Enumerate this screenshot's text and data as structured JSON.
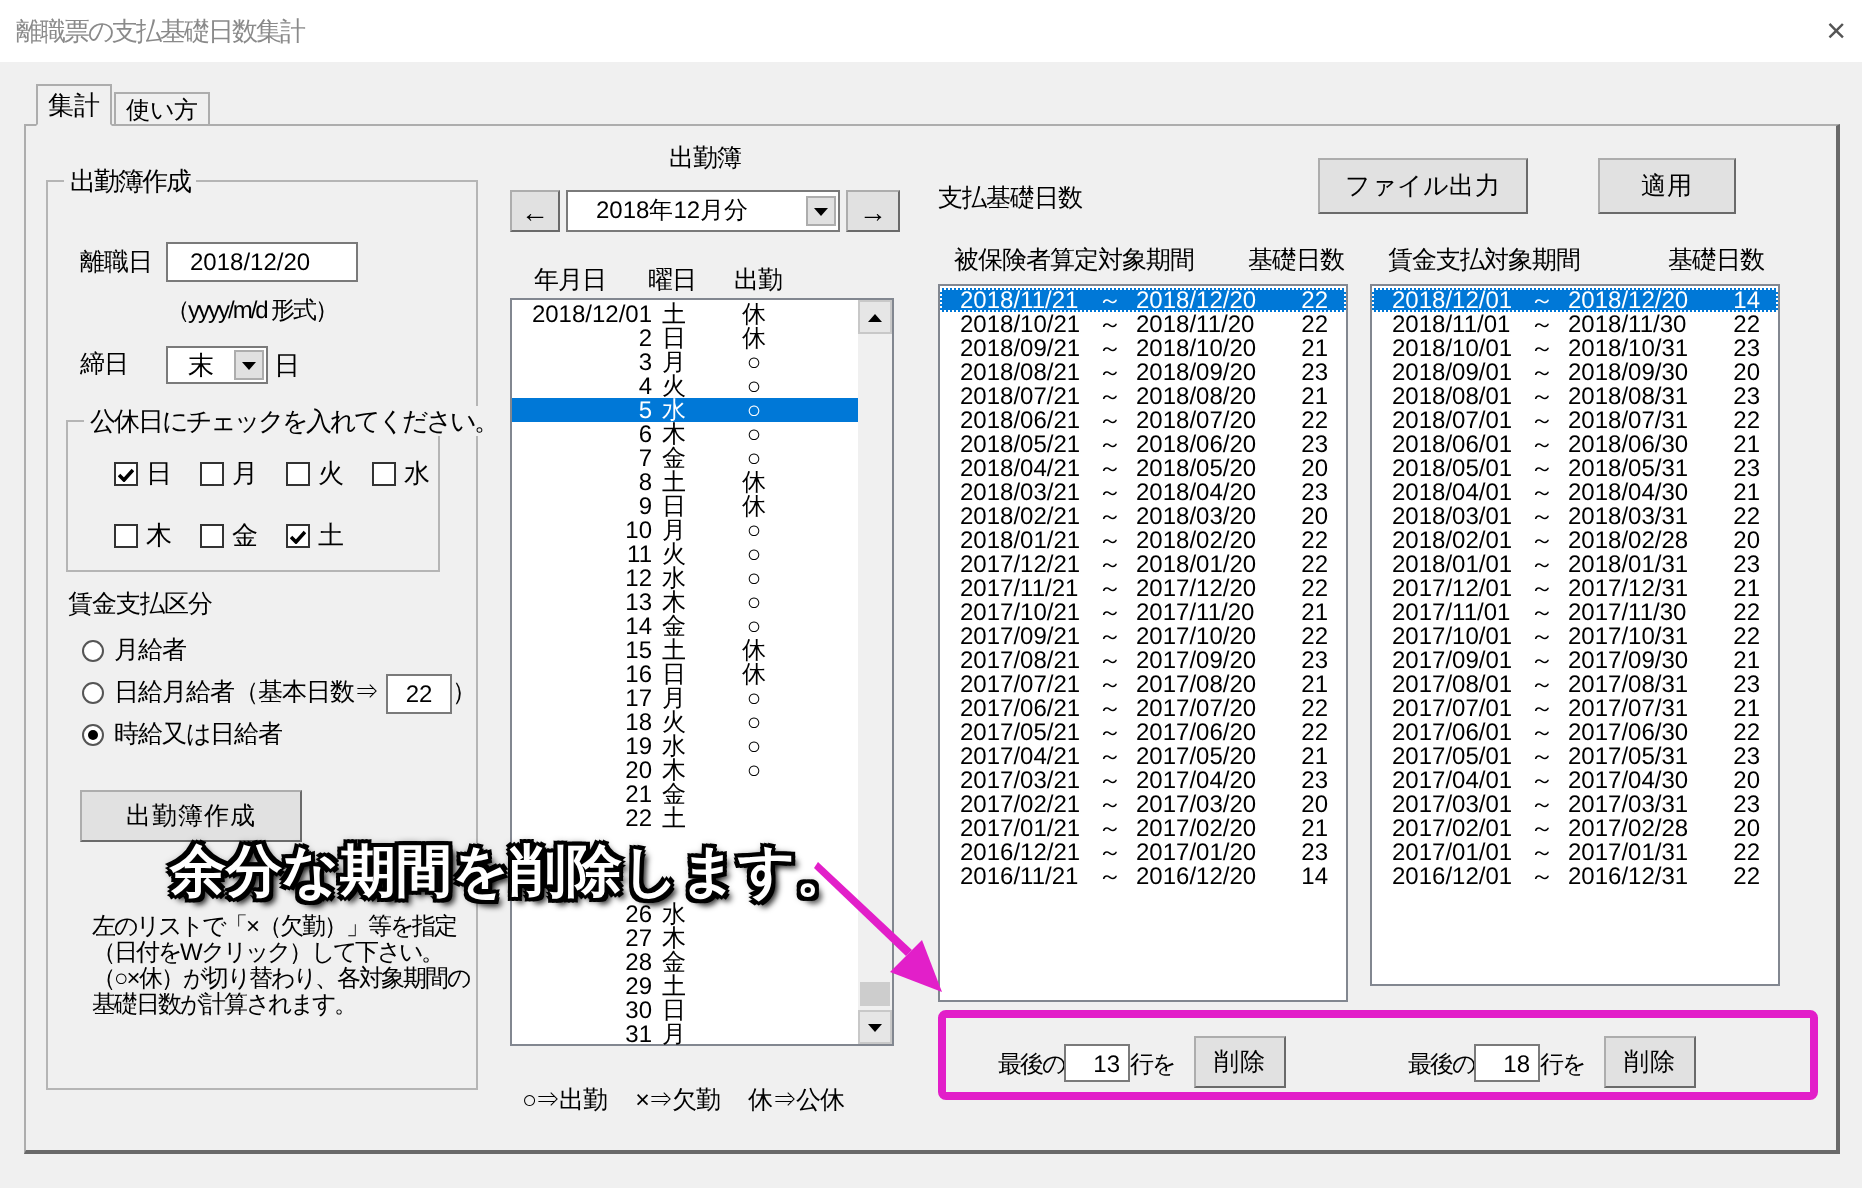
{
  "window": {
    "title": "離職票の支払基礎日数集計",
    "close": "×"
  },
  "tabs": [
    {
      "label": "集計",
      "selected": true
    },
    {
      "label": "使い方",
      "selected": false
    }
  ],
  "attendance_setup": {
    "title": "出勤簿作成",
    "leave_date_label": "離職日",
    "leave_date": "2018/12/20",
    "format_hint": "（yyyy/m/d 形式）",
    "closing_label": "締日",
    "closing_value": "末",
    "closing_suffix": "日",
    "holidays": {
      "title": "公休日にチェックを入れてください。",
      "days": [
        {
          "label": "日",
          "checked": true
        },
        {
          "label": "月",
          "checked": false
        },
        {
          "label": "火",
          "checked": false
        },
        {
          "label": "水",
          "checked": false
        },
        {
          "label": "木",
          "checked": false
        },
        {
          "label": "金",
          "checked": false
        },
        {
          "label": "土",
          "checked": true
        }
      ]
    },
    "wage_title": "賃金支払区分",
    "wage_options": [
      {
        "kind": "plain",
        "label": "月給者",
        "selected": false
      },
      {
        "kind": "with_days",
        "label": "日給月給者（基本日数⇒",
        "days": "22",
        "suffix": "）",
        "selected": false
      },
      {
        "kind": "plain",
        "label": "時給又は日給者",
        "selected": true
      }
    ],
    "create_button": "出勤簿作成",
    "note": "左のリストで「×（欠勤）」等を指定（日付をWクリック）して下さい。（○×休）が切り替わり、各対象期間の基礎日数が計算されます。"
  },
  "attendance_book": {
    "title": "出勤簿",
    "prev": "←",
    "month": "2018年12月分",
    "next": "→",
    "columns": [
      "年月日",
      "曜日",
      "出勤"
    ],
    "rows": [
      {
        "kind": "day",
        "date": "2018/12/01",
        "weekday": "土",
        "status": "休",
        "selected": false
      },
      {
        "kind": "day",
        "date": "2",
        "weekday": "日",
        "status": "休",
        "selected": false
      },
      {
        "kind": "day",
        "date": "3",
        "weekday": "月",
        "status": "○",
        "selected": false
      },
      {
        "kind": "day",
        "date": "4",
        "weekday": "火",
        "status": "○",
        "selected": false
      },
      {
        "kind": "day",
        "date": "5",
        "weekday": "水",
        "status": "○",
        "selected": true
      },
      {
        "kind": "day",
        "date": "6",
        "weekday": "木",
        "status": "○",
        "selected": false
      },
      {
        "kind": "day",
        "date": "7",
        "weekday": "金",
        "status": "○",
        "selected": false
      },
      {
        "kind": "day",
        "date": "8",
        "weekday": "土",
        "status": "休",
        "selected": false
      },
      {
        "kind": "day",
        "date": "9",
        "weekday": "日",
        "status": "休",
        "selected": false
      },
      {
        "kind": "day",
        "date": "10",
        "weekday": "月",
        "status": "○",
        "selected": false
      },
      {
        "kind": "day",
        "date": "11",
        "weekday": "火",
        "status": "○",
        "selected": false
      },
      {
        "kind": "day",
        "date": "12",
        "weekday": "水",
        "status": "○",
        "selected": false
      },
      {
        "kind": "day",
        "date": "13",
        "weekday": "木",
        "status": "○",
        "selected": false
      },
      {
        "kind": "day",
        "date": "14",
        "weekday": "金",
        "status": "○",
        "selected": false
      },
      {
        "kind": "day",
        "date": "15",
        "weekday": "土",
        "status": "休",
        "selected": false
      },
      {
        "kind": "day",
        "date": "16",
        "weekday": "日",
        "status": "休",
        "selected": false
      },
      {
        "kind": "day",
        "date": "17",
        "weekday": "月",
        "status": "○",
        "selected": false
      },
      {
        "kind": "day",
        "date": "18",
        "weekday": "火",
        "status": "○",
        "selected": false
      },
      {
        "kind": "day",
        "date": "19",
        "weekday": "水",
        "status": "○",
        "selected": false
      },
      {
        "kind": "day",
        "date": "20",
        "weekday": "木",
        "status": "○",
        "selected": false
      },
      {
        "kind": "day",
        "date": "21",
        "weekday": "金",
        "selected": false
      },
      {
        "kind": "day",
        "date": "22",
        "weekday": "土",
        "selected": false
      },
      {
        "kind": "covered",
        "selected": false
      },
      {
        "kind": "covered",
        "selected": false
      },
      {
        "kind": "covered",
        "selected": false
      },
      {
        "kind": "day",
        "date": "26",
        "weekday": "水",
        "selected": false
      },
      {
        "kind": "day",
        "date": "27",
        "weekday": "木",
        "selected": false
      },
      {
        "kind": "day",
        "date": "28",
        "weekday": "金",
        "selected": false
      },
      {
        "kind": "day",
        "date": "29",
        "weekday": "土",
        "selected": false
      },
      {
        "kind": "day",
        "date": "30",
        "weekday": "日",
        "selected": false
      },
      {
        "kind": "day",
        "date": "31",
        "weekday": "月",
        "selected": false
      }
    ],
    "legend": [
      "○⇒出勤",
      "×⇒欠勤",
      "休⇒公休"
    ]
  },
  "basic_days": {
    "title": "支払基礎日数",
    "buttons": [
      "ファイル出力",
      "適用"
    ],
    "insured_list": {
      "columns": [
        "被保険者算定対象期間",
        "基礎日数"
      ],
      "rows": [
        {
          "start": "2018/11/21",
          "sep": "～",
          "end": "2018/12/20",
          "days": "22",
          "selected": true
        },
        {
          "start": "2018/10/21",
          "sep": "～",
          "end": "2018/11/20",
          "days": "22",
          "selected": false
        },
        {
          "start": "2018/09/21",
          "sep": "～",
          "end": "2018/10/20",
          "days": "21",
          "selected": false
        },
        {
          "start": "2018/08/21",
          "sep": "～",
          "end": "2018/09/20",
          "days": "23",
          "selected": false
        },
        {
          "start": "2018/07/21",
          "sep": "～",
          "end": "2018/08/20",
          "days": "21",
          "selected": false
        },
        {
          "start": "2018/06/21",
          "sep": "～",
          "end": "2018/07/20",
          "days": "22",
          "selected": false
        },
        {
          "start": "2018/05/21",
          "sep": "～",
          "end": "2018/06/20",
          "days": "23",
          "selected": false
        },
        {
          "start": "2018/04/21",
          "sep": "～",
          "end": "2018/05/20",
          "days": "20",
          "selected": false
        },
        {
          "start": "2018/03/21",
          "sep": "～",
          "end": "2018/04/20",
          "days": "23",
          "selected": false
        },
        {
          "start": "2018/02/21",
          "sep": "～",
          "end": "2018/03/20",
          "days": "20",
          "selected": false
        },
        {
          "start": "2018/01/21",
          "sep": "～",
          "end": "2018/02/20",
          "days": "22",
          "selected": false
        },
        {
          "start": "2017/12/21",
          "sep": "～",
          "end": "2018/01/20",
          "days": "22",
          "selected": false
        },
        {
          "start": "2017/11/21",
          "sep": "～",
          "end": "2017/12/20",
          "days": "22",
          "selected": false
        },
        {
          "start": "2017/10/21",
          "sep": "～",
          "end": "2017/11/20",
          "days": "21",
          "selected": false
        },
        {
          "start": "2017/09/21",
          "sep": "～",
          "end": "2017/10/20",
          "days": "22",
          "selected": false
        },
        {
          "start": "2017/08/21",
          "sep": "～",
          "end": "2017/09/20",
          "days": "23",
          "selected": false
        },
        {
          "start": "2017/07/21",
          "sep": "～",
          "end": "2017/08/20",
          "days": "21",
          "selected": false
        },
        {
          "start": "2017/06/21",
          "sep": "～",
          "end": "2017/07/20",
          "days": "22",
          "selected": false
        },
        {
          "start": "2017/05/21",
          "sep": "～",
          "end": "2017/06/20",
          "days": "22",
          "selected": false
        },
        {
          "start": "2017/04/21",
          "sep": "～",
          "end": "2017/05/20",
          "days": "21",
          "selected": false
        },
        {
          "start": "2017/03/21",
          "sep": "～",
          "end": "2017/04/20",
          "days": "23",
          "selected": false
        },
        {
          "start": "2017/02/21",
          "sep": "～",
          "end": "2017/03/20",
          "days": "20",
          "selected": false
        },
        {
          "start": "2017/01/21",
          "sep": "～",
          "end": "2017/02/20",
          "days": "21",
          "selected": false
        },
        {
          "start": "2016/12/21",
          "sep": "～",
          "end": "2017/01/20",
          "days": "23",
          "selected": false
        },
        {
          "start": "2016/11/21",
          "sep": "～",
          "end": "2016/12/20",
          "days": "14",
          "selected": false
        }
      ]
    },
    "wage_list": {
      "columns": [
        "賃金支払対象期間",
        "基礎日数"
      ],
      "rows": [
        {
          "start": "2018/12/01",
          "sep": "～",
          "end": "2018/12/20",
          "days": "14",
          "selected": true
        },
        {
          "start": "2018/11/01",
          "sep": "～",
          "end": "2018/11/30",
          "days": "22",
          "selected": false
        },
        {
          "start": "2018/10/01",
          "sep": "～",
          "end": "2018/10/31",
          "days": "23",
          "selected": false
        },
        {
          "start": "2018/09/01",
          "sep": "～",
          "end": "2018/09/30",
          "days": "20",
          "selected": false
        },
        {
          "start": "2018/08/01",
          "sep": "～",
          "end": "2018/08/31",
          "days": "23",
          "selected": false
        },
        {
          "start": "2018/07/01",
          "sep": "～",
          "end": "2018/07/31",
          "days": "22",
          "selected": false
        },
        {
          "start": "2018/06/01",
          "sep": "～",
          "end": "2018/06/30",
          "days": "21",
          "selected": false
        },
        {
          "start": "2018/05/01",
          "sep": "～",
          "end": "2018/05/31",
          "days": "23",
          "selected": false
        },
        {
          "start": "2018/04/01",
          "sep": "～",
          "end": "2018/04/30",
          "days": "21",
          "selected": false
        },
        {
          "start": "2018/03/01",
          "sep": "～",
          "end": "2018/03/31",
          "days": "22",
          "selected": false
        },
        {
          "start": "2018/02/01",
          "sep": "～",
          "end": "2018/02/28",
          "days": "20",
          "selected": false
        },
        {
          "start": "2018/01/01",
          "sep": "～",
          "end": "2018/01/31",
          "days": "23",
          "selected": false
        },
        {
          "start": "2017/12/01",
          "sep": "～",
          "end": "2017/12/31",
          "days": "21",
          "selected": false
        },
        {
          "start": "2017/11/01",
          "sep": "～",
          "end": "2017/11/30",
          "days": "22",
          "selected": false
        },
        {
          "start": "2017/10/01",
          "sep": "～",
          "end": "2017/10/31",
          "days": "22",
          "selected": false
        },
        {
          "start": "2017/09/01",
          "sep": "～",
          "end": "2017/09/30",
          "days": "21",
          "selected": false
        },
        {
          "start": "2017/08/01",
          "sep": "～",
          "end": "2017/08/31",
          "days": "23",
          "selected": false
        },
        {
          "start": "2017/07/01",
          "sep": "～",
          "end": "2017/07/31",
          "days": "21",
          "selected": false
        },
        {
          "start": "2017/06/01",
          "sep": "～",
          "end": "2017/06/30",
          "days": "22",
          "selected": false
        },
        {
          "start": "2017/05/01",
          "sep": "～",
          "end": "2017/05/31",
          "days": "23",
          "selected": false
        },
        {
          "start": "2017/04/01",
          "sep": "～",
          "end": "2017/04/30",
          "days": "20",
          "selected": false
        },
        {
          "start": "2017/03/01",
          "sep": "～",
          "end": "2017/03/31",
          "days": "23",
          "selected": false
        },
        {
          "start": "2017/02/01",
          "sep": "～",
          "end": "2017/02/28",
          "days": "20",
          "selected": false
        },
        {
          "start": "2017/01/01",
          "sep": "～",
          "end": "2017/01/31",
          "days": "22",
          "selected": false
        },
        {
          "start": "2016/12/01",
          "sep": "～",
          "end": "2016/12/31",
          "days": "22",
          "selected": false
        }
      ]
    },
    "trim": [
      {
        "prefix": "最後の",
        "count": "13",
        "suffix": "行を",
        "button": "削除"
      },
      {
        "prefix": "最後の",
        "count": "18",
        "suffix": "行を",
        "button": "削除"
      }
    ]
  },
  "annotation": {
    "caption": "余分な期間を削除します。"
  }
}
